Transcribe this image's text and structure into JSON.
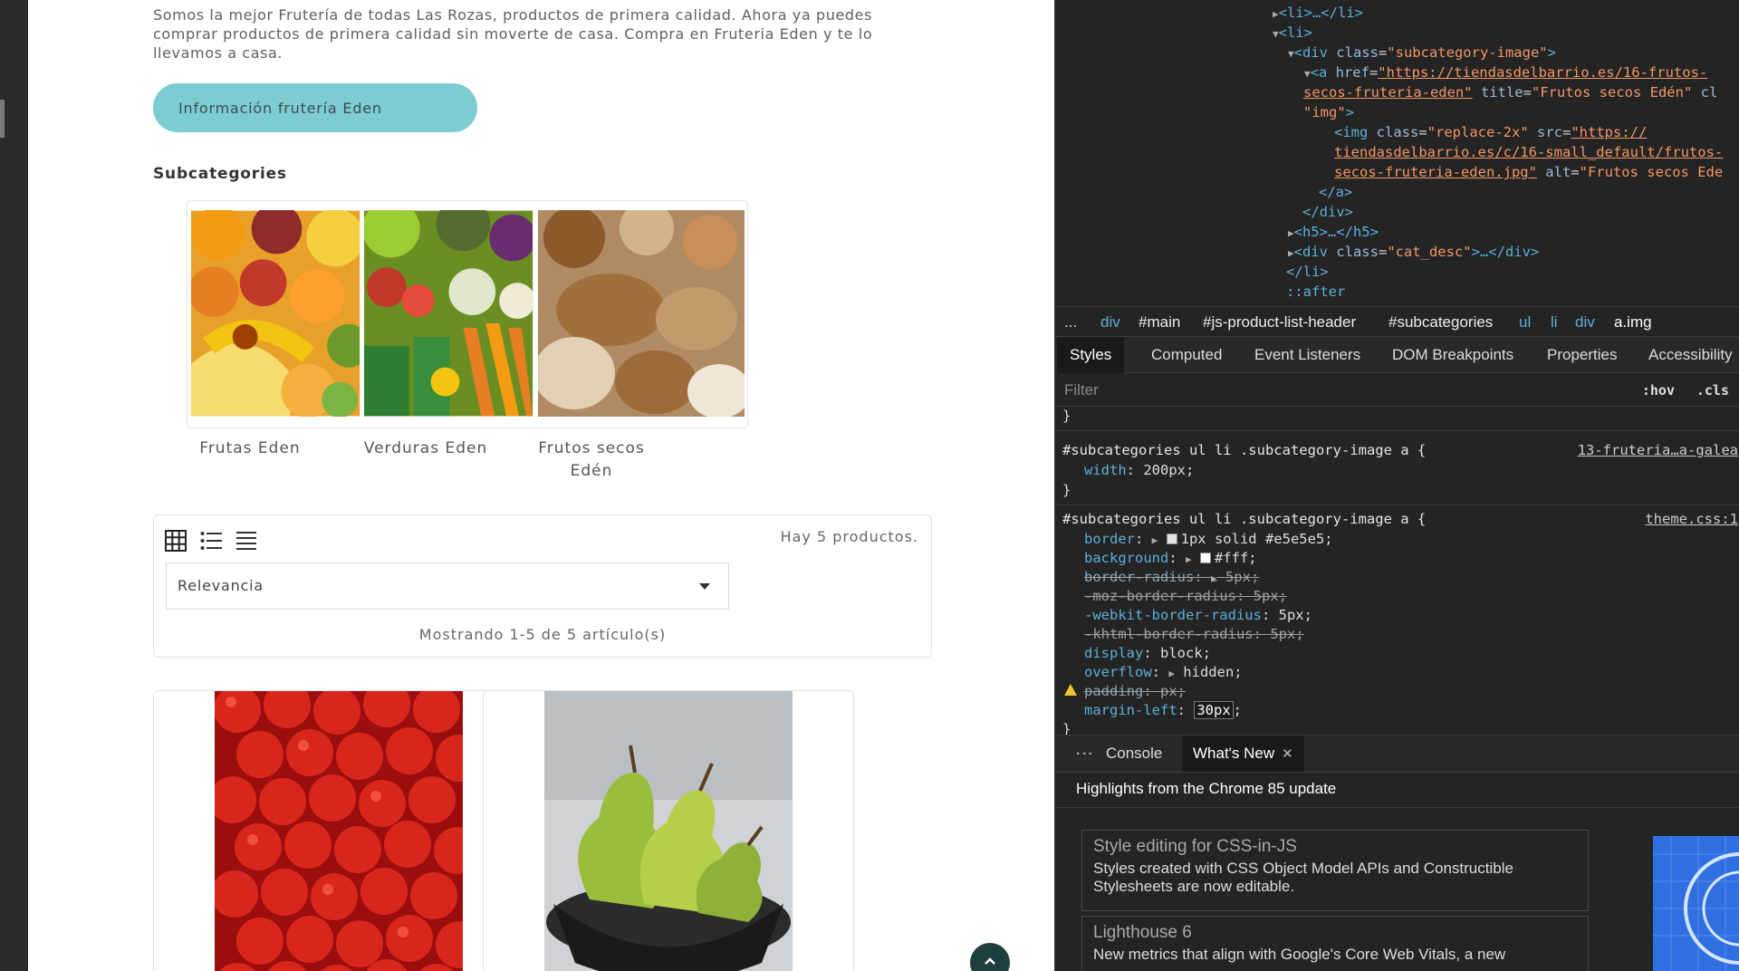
{
  "site": {
    "intro": "Somos la mejor Frutería de todas Las Rozas, productos de primera calidad. Ahora ya puedes comprar productos de primera calidad sin moverte de casa. Compra en Fruteria Eden y te lo llevamos a casa.",
    "info_button": "Información frutería Eden",
    "subcategories_title": "Subcategories",
    "subcategories": [
      {
        "label": "Frutas Eden"
      },
      {
        "label": "Verduras Eden"
      },
      {
        "label": "Frutos secos Edén"
      }
    ],
    "product_count": "Hay 5 productos.",
    "sort_value": "Relevancia",
    "showing": "Mostrando 1-5 de 5 artículo(s)",
    "view_icons": [
      "grid-view-icon",
      "list-view-icon",
      "table-view-icon"
    ]
  },
  "devtools": {
    "dom_lines": {
      "l1": "<li>…</li>",
      "l2": "<li>",
      "l3_tag": "<div ",
      "l3_attr": "class",
      "l3_val": "\"subcategory-image\"",
      "l4_tag": "<a ",
      "l4_attr": "href",
      "l4_link": "\"https://tiendasdelbarrio.es/16-frutos-",
      "l5_link": "secos-fruteria-eden\"",
      "l5_attr": " title",
      "l5_val": "\"Frutos secos Edén\"",
      "l5_rest": " cl",
      "l6_val": "\"img\"",
      "l6_tag": ">",
      "l7_tag": "<img ",
      "l7_attr1": "class",
      "l7_val1": "\"replace-2x\"",
      "l7_attr2": " src",
      "l7_link": "\"https://",
      "l8_link": "tiendasdelbarrio.es/c/16-small_default/frutos-",
      "l9_link": "secos-fruteria-eden.jpg\"",
      "l9_attr": " alt",
      "l9_val": "\"Frutos secos Ede",
      "l10": "</a>",
      "l11": "</div>",
      "l12": "<h5>…</h5>",
      "l13_tag": "<div ",
      "l13_attr": "class",
      "l13_val": "\"cat_desc\"",
      "l13_rest": ">…</div>",
      "l14": "</li>",
      "l15": "::after"
    },
    "breadcrumbs": [
      "...",
      "div",
      "#main",
      "#js-product-list-header",
      "#subcategories",
      "ul",
      "li",
      "div",
      "a.img"
    ],
    "tabs": [
      "Styles",
      "Computed",
      "Event Listeners",
      "DOM Breakpoints",
      "Properties",
      "Accessibility"
    ],
    "filter_placeholder": "Filter",
    "hov": ":hov",
    "cls": ".cls",
    "styles": {
      "brace_close": "}",
      "rule1_selector": "#subcategories ul li .subcategory-image a {",
      "rule1_source": "13-fruteria…a-galea",
      "rule1_prop": "width",
      "rule1_value": "200px",
      "rule2_selector": "#subcategories ul li .subcategory-image a {",
      "rule2_source": "theme.css:1",
      "border_prop": "border",
      "border_value": "1px solid #e5e5e5",
      "background_prop": "background",
      "background_value": "#fff",
      "radius_prop": "border-radius",
      "radius_value": "5px",
      "moz_prop": "-moz-border-radius",
      "moz_value": "5px",
      "webkit_prop": "-webkit-border-radius",
      "webkit_value": "5px",
      "khtml_prop": "-khtml-border-radius",
      "khtml_value": "5px",
      "display_prop": "display",
      "display_value": "block",
      "overflow_prop": "overflow",
      "overflow_value": "hidden",
      "padding_prop": "padding",
      "padding_value": "px",
      "margin_prop": "margin-left",
      "margin_value": "30px"
    },
    "drawer_tabs": [
      "Console",
      "What's New"
    ],
    "highlights": "Highlights from the Chrome 85 update",
    "cards": [
      {
        "title": "Style editing for CSS-in-JS",
        "body": "Styles created with CSS Object Model APIs and Constructible Stylesheets are now editable."
      },
      {
        "title": "Lighthouse 6",
        "body": "New metrics that align with Google's Core Web Vitals, a new"
      }
    ]
  },
  "colors": {
    "accent_button": "#7ccdd1",
    "scroll_top": "#1f3f3d",
    "devtools_bg": "#242424"
  }
}
